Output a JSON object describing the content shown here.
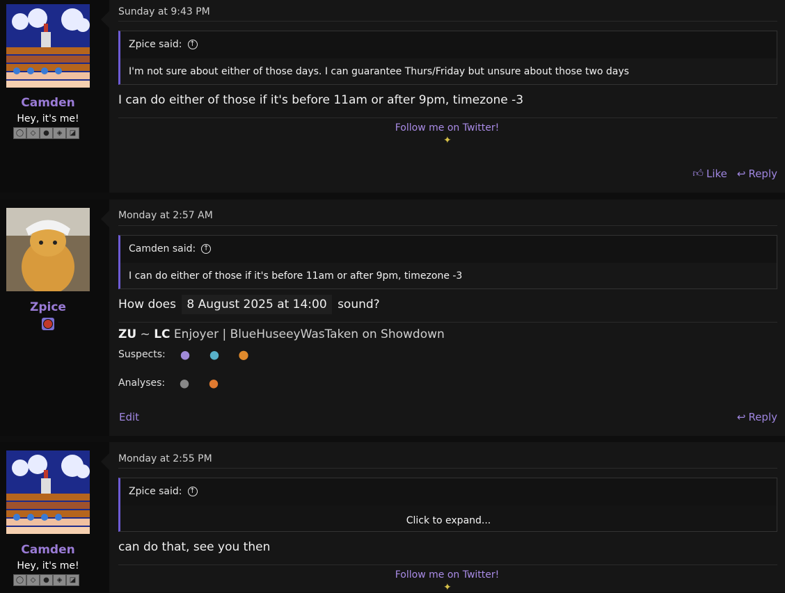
{
  "posts": [
    {
      "user": "Camden",
      "user_title": "Hey, it's me!",
      "time": "Sunday at 9:43 PM",
      "quote_author": "Zpice said:",
      "quote_text": "I'm not sure about either of those days. I can guarantee Thurs/Friday but unsure about those two days",
      "message": "I can do either of those if it's before 11am or after 9pm, timezone -3",
      "sig_link": "Follow me on Twitter!",
      "like_label": "Like",
      "reply_label": "Reply"
    },
    {
      "user": "Zpice",
      "time": "Monday at 2:57 AM",
      "quote_author": "Camden said:",
      "quote_text": "I can do either of those if it's before 11am or after 9pm, timezone -3",
      "message_pre": "How does",
      "message_date": "8 August 2025 at 14:00",
      "message_post": "sound?",
      "sig_zu": "ZU",
      "sig_tilde": "~",
      "sig_lc": "LC",
      "sig_rest": "Enjoyer | BlueHuseeyWasTaken on Showdown",
      "suspects_label": "Suspects:",
      "analyses_label": "Analyses:",
      "edit_label": "Edit",
      "reply_label": "Reply"
    },
    {
      "user": "Camden",
      "user_title": "Hey, it's me!",
      "time": "Monday at 2:55 PM",
      "quote_author": "Zpice said:",
      "expand_label": "Click to expand...",
      "message": "can do that, see you then",
      "sig_link": "Follow me on Twitter!"
    }
  ],
  "colors": {
    "accent": "#9a7bd6",
    "quote_border": "#6e5cd6",
    "link": "#a98be6"
  }
}
